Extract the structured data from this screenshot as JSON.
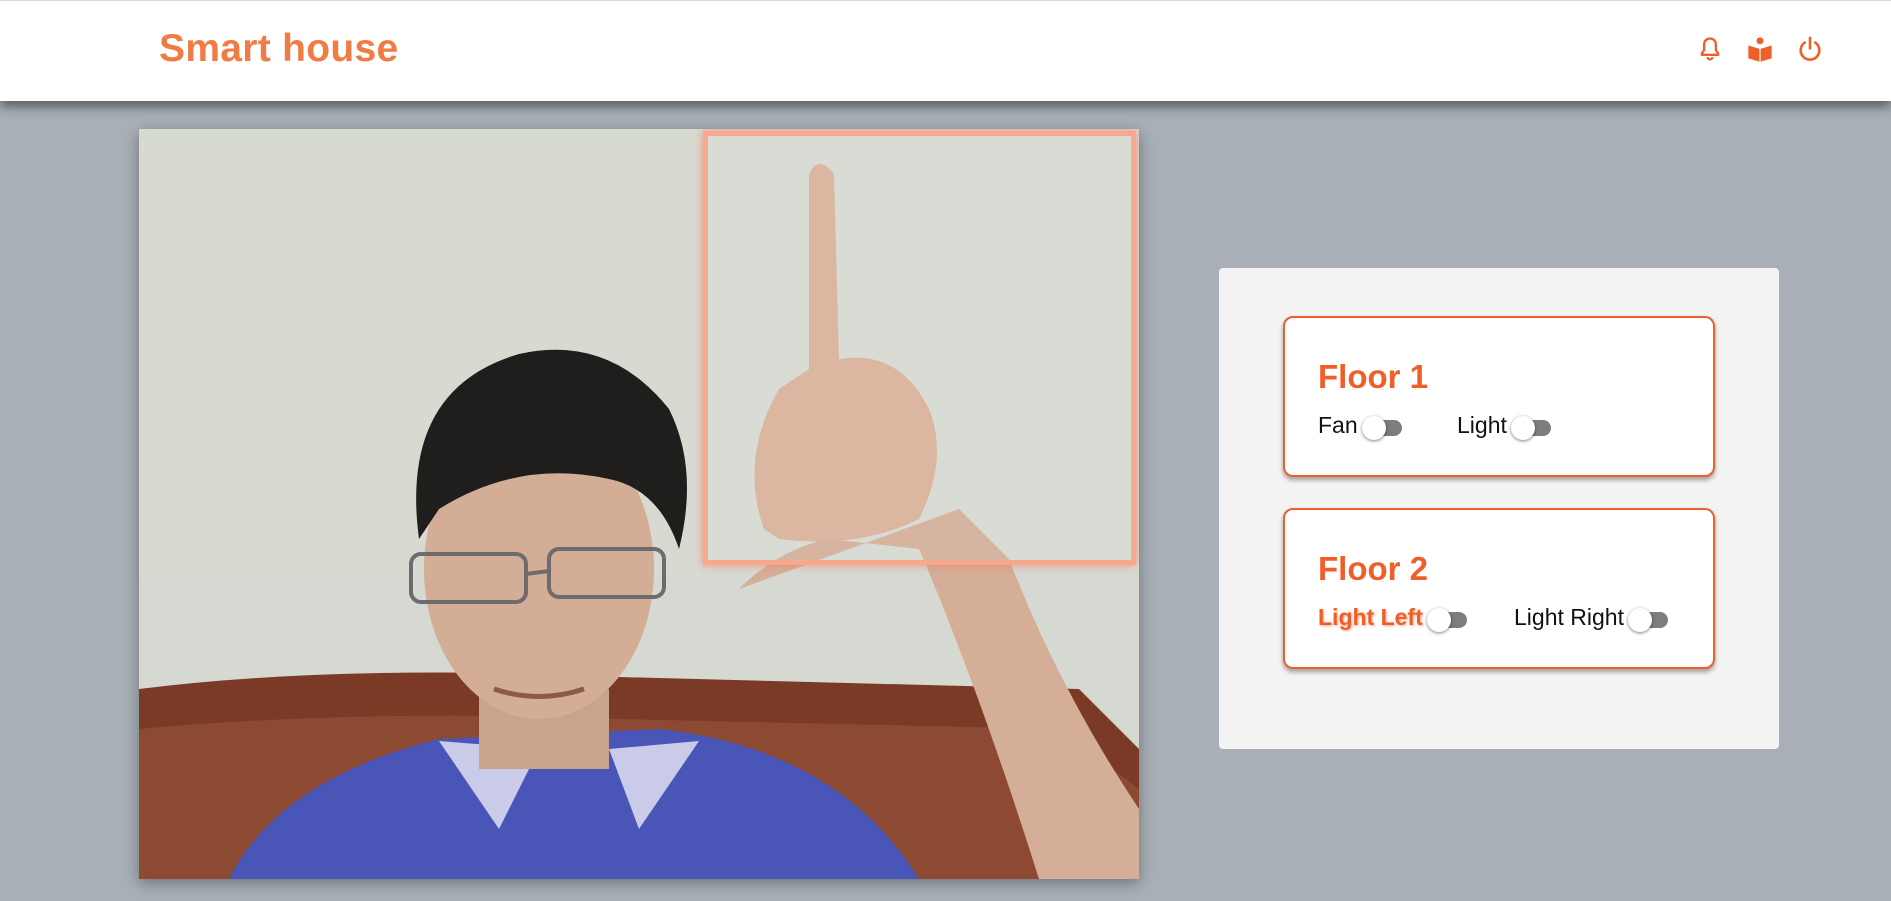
{
  "app": {
    "title": "Smart house"
  },
  "header": {
    "icons": [
      "bell-icon",
      "book-reader-icon",
      "power-icon"
    ],
    "accent_color": "#ee5f2a"
  },
  "camera": {
    "feed": "webcam-feed",
    "detection_box_color": "#f7a88f"
  },
  "floors": [
    {
      "title": "Floor 1",
      "devices": [
        {
          "label": "Fan",
          "on": false
        },
        {
          "label": "Light",
          "on": false
        }
      ]
    },
    {
      "title": "Floor 2",
      "devices": [
        {
          "label": "Light Left",
          "on": false,
          "highlighted": true
        },
        {
          "label": "Light Right",
          "on": false
        }
      ]
    }
  ]
}
